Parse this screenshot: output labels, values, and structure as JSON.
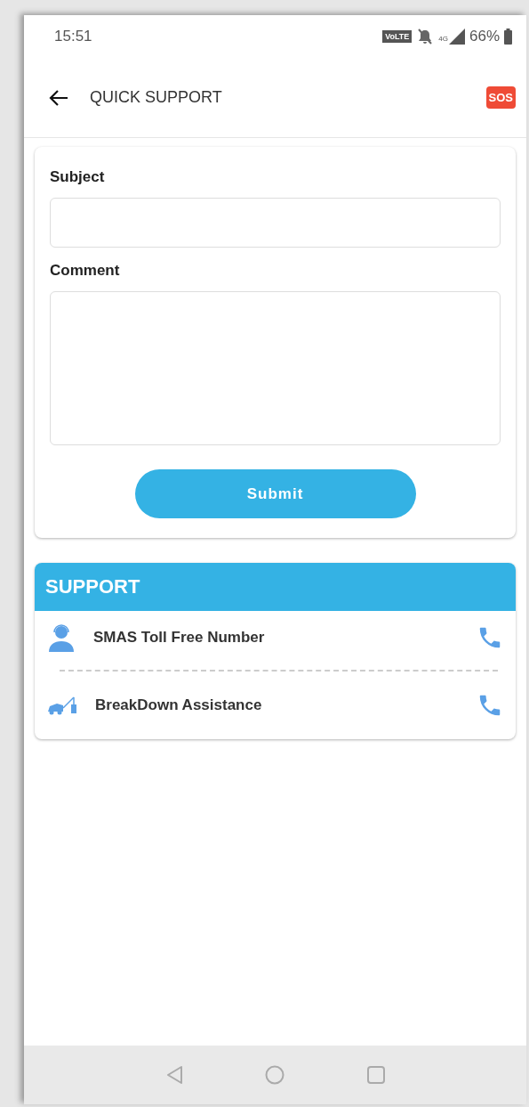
{
  "status_bar": {
    "time": "15:51",
    "network_badge": "VoLTE",
    "network_type": "4G",
    "battery": "66%"
  },
  "app_bar": {
    "title": "QUICK SUPPORT",
    "sos_button": "SOS"
  },
  "form": {
    "fields": [
      {
        "label": "Subject",
        "kind": "line"
      },
      {
        "label": "Comment",
        "kind": "area"
      }
    ],
    "submit": "Submit"
  },
  "support": {
    "title": "SUPPORT",
    "items": [
      {
        "label": "SMAS Toll Free Number",
        "kind": "agent"
      },
      {
        "label": "BreakDown Assistance",
        "kind": "tow"
      }
    ]
  }
}
